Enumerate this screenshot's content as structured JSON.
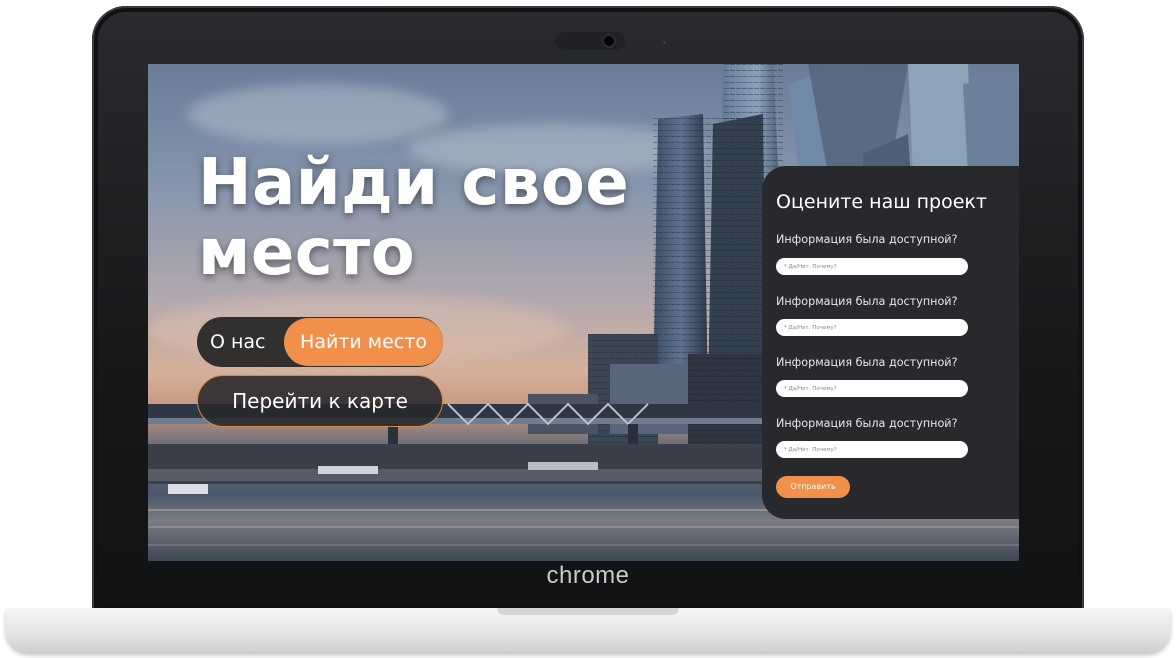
{
  "hero": {
    "title": "Найди свое место"
  },
  "nav": {
    "about_label": "О нас",
    "find_label": "Найти место"
  },
  "map_button_label": "Перейти к карте",
  "feedback": {
    "title": "Оцените наш проект",
    "questions": [
      {
        "label": "Информация была доступной?",
        "placeholder": "* Да/Нет. Почему?"
      },
      {
        "label": "Информация была доступной?",
        "placeholder": "* Да/Нет. Почему?"
      },
      {
        "label": "Информация была доступной?",
        "placeholder": "* Да/Нет. Почему?"
      },
      {
        "label": "Информация была доступной?",
        "placeholder": "* Да/Нет. Почему?"
      }
    ],
    "submit_label": "Отправить"
  },
  "device": {
    "brand_label": "chrome"
  },
  "colors": {
    "accent": "#f0904a",
    "panel": "#27292c",
    "pill_dark": "#202022"
  }
}
